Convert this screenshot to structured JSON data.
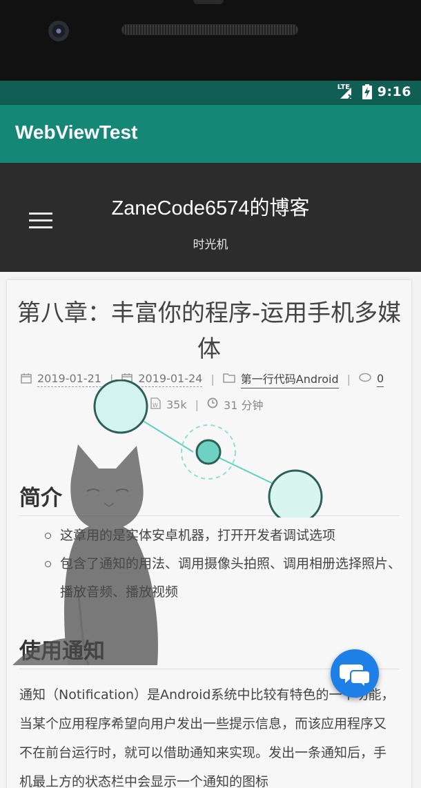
{
  "status_bar": {
    "network": "LTE",
    "time": "9:16"
  },
  "app_bar": {
    "title": "WebViewTest"
  },
  "blog": {
    "title": "ZaneCode6574的博客",
    "subtitle": "时光机"
  },
  "post": {
    "title": "第八章：丰富你的程序-运用手机多媒体",
    "meta": {
      "created": "2019-01-21",
      "updated": "2019-01-24",
      "category": "第一行代码Android",
      "comments": "0",
      "word_count": "35k",
      "read_time": "31 分钟"
    },
    "section1": {
      "heading": "简介",
      "bullets": [
        "这章用的是实体安卓机器，打开开发者调试选项",
        "包含了通知的用法、调用摄像头拍照、调用相册选择照片、播放音频、播放视频"
      ]
    },
    "section2": {
      "heading": "使用通知",
      "paragraph": "通知（Notification）是Android系统中比较有特色的一个功能，当某个应用程序希望向用户发出一些提示信息，而该应用程序又不在前台运行时，就可以借助通知来实现。发出一条通知后，手机最上方的状态栏中会显示一个通知的图标"
    }
  },
  "icons": {
    "menu": "hamburger-menu-icon",
    "calendar": "calendar-icon",
    "folder": "folder-icon",
    "comment": "comment-icon",
    "word": "file-word-icon",
    "clock": "clock-icon",
    "chat": "chat-bubbles-icon"
  },
  "colors": {
    "status_bar": "#0f5f54",
    "app_bar": "#148777",
    "blog_header": "#2c2c2c",
    "fab": "#1e7fe6",
    "accent_teal": "#5fd0c0"
  }
}
